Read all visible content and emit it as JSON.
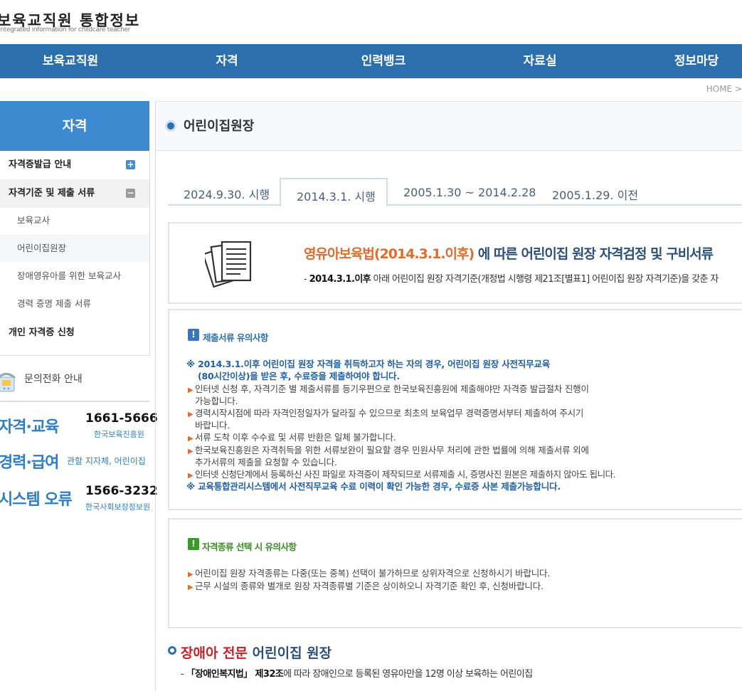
{
  "header": {
    "title": "보육교직원 통합정보",
    "subtitle": "Integrated information for childcare teacher"
  },
  "nav": {
    "items": [
      "보육교직원",
      "자격",
      "인력뱅크",
      "자료실",
      "정보마당"
    ]
  },
  "breadcrumb": "HOME  >",
  "sidebar": {
    "title": "자격",
    "items": [
      {
        "label": "자격증발급 안내"
      },
      {
        "label": "자격기준 및 제출 서류"
      },
      {
        "label": "보육교사"
      },
      {
        "label": "어린이집원장"
      },
      {
        "label": "장애영유아를 위한 보육교사"
      },
      {
        "label": "경력 증명 제출 서류"
      },
      {
        "label": "개인 자격증 신청"
      }
    ],
    "contact": {
      "heading": "문의전화 안내",
      "rows": [
        {
          "label": "자격·교육",
          "number": "1661-5666",
          "org": "한국보육진흥원"
        },
        {
          "label": "경력·급여",
          "org": "관할 지자체, 어린이집"
        },
        {
          "label": "시스템 오류",
          "number": "1566-3232",
          "org": "한국사회보장정보원"
        }
      ]
    }
  },
  "main": {
    "page_title": "어린이집원장",
    "tabs": [
      {
        "label": "2024.9.30. 시행"
      },
      {
        "label": "2014.3.1. 시행"
      },
      {
        "label": "2005.1.30 ~ 2014.2.28"
      },
      {
        "label": "2005.1.29. 이전"
      }
    ],
    "intro": {
      "law": "영유아보육법(2014.3.1.이후)",
      "title_rest": " 에 따른 어린이집 원장 자격검정 및 구비서류",
      "desc_prefix": "- ",
      "desc_bold": "2014.3.1.이후",
      "desc_rest": " 아래 어린이집 원장 자격기준(개정법 시행령 제21조[별표1] 어린이집 원장 자격기준)을 갖춘 자"
    },
    "notice1": {
      "heading": "제출서류 유의사항",
      "lines": [
        "※ 2014.3.1.이후 어린이집 원장 자격을 취득하고자 하는 자의 경우, 어린이집 원장 사전직무교육",
        "(80시간이상)을 받은 후, 수료증을 제출하여야 합니다.",
        "인터넷 신청 후, 자격기준 별 제출서류를 등기우편으로 한국보육진흥원에 제출해야만 자격증 발급절차 진행이",
        "가능합니다.",
        "경력시작시점에 따라 자격인정일자가 달라질 수 있으므로 최초의 보육업무 경력증명서부터 제출하여 주시기",
        "바랍니다.",
        "서류 도착 이후 수수료 및 서류 반환은 일체 불가합니다.",
        "한국보육진흥원은 자격취득을 위한 서류보완이 필요할 경우 민원사무 처리에 관한 법률에 의해 제출서류 외에",
        "추가서류의 제출을 요청할 수 있습니다.",
        "인터넷 신청단계에서 등록하신 사진 파일로 자격증이 제작되므로 서류제출 시, 증명사진 원본은 제출하지 않아도 됩니다.",
        "※ 교육통합관리시스템에서 사전직무교육 수료 이력이 확인 가능한 경우, 수료증 사본 제출가능합니다."
      ]
    },
    "notice2": {
      "heading": "자격종류 선택 시 유의사항",
      "lines": [
        "어린이집 원장 자격종류는 다중(또는 중복) 선택이 불가하므로 상위자격으로 신청하시기 바랍니다.",
        "근무 시설의 종류와 별개로 원장 자격종류별 기준은 상이하오니 자격기준 확인 후, 신청바랍니다."
      ]
    },
    "section2": {
      "title_red": "장애아 전문",
      "title_rest": " 어린이집 원장",
      "desc_prefix": "- ",
      "desc_bold": "「장애인복지법」 제32조",
      "desc_rest": "에 따라 장애인으로 등록된 영유아만을 12명 이상 보육하는 어린이집"
    }
  },
  "colors": {
    "nav_bg": "#2c6fad",
    "sidebar_head_bg": "#3d8ad0",
    "accent_orange": "#e06b2a",
    "accent_blue": "#1f5fa8",
    "accent_green": "#3a9a2a",
    "accent_red": "#c8202a"
  }
}
